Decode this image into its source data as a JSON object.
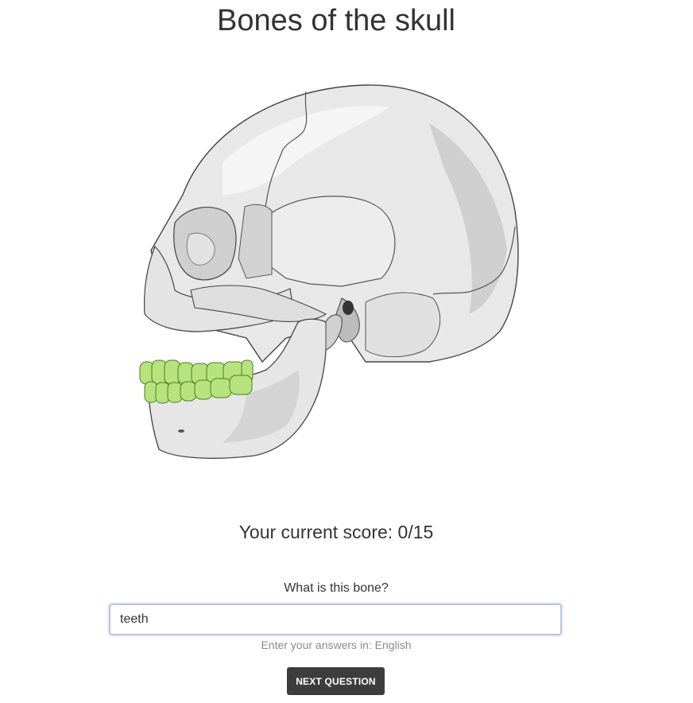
{
  "page": {
    "title": "Bones of the skull"
  },
  "quiz": {
    "score_text": "Your current score: 0/15",
    "question": "What is this bone?",
    "answer_value": "teeth",
    "language_hint": "Enter your answers in: English",
    "next_button_label": "NEXT QUESTION"
  },
  "illustration": {
    "subject": "skull-lateral-view",
    "highlighted_part": "teeth",
    "highlight_color": "#b6e37e",
    "highlight_stroke": "#5a8a2a",
    "bone_color": "#e6e6e6",
    "shadow_color": "#c4c4c4"
  }
}
